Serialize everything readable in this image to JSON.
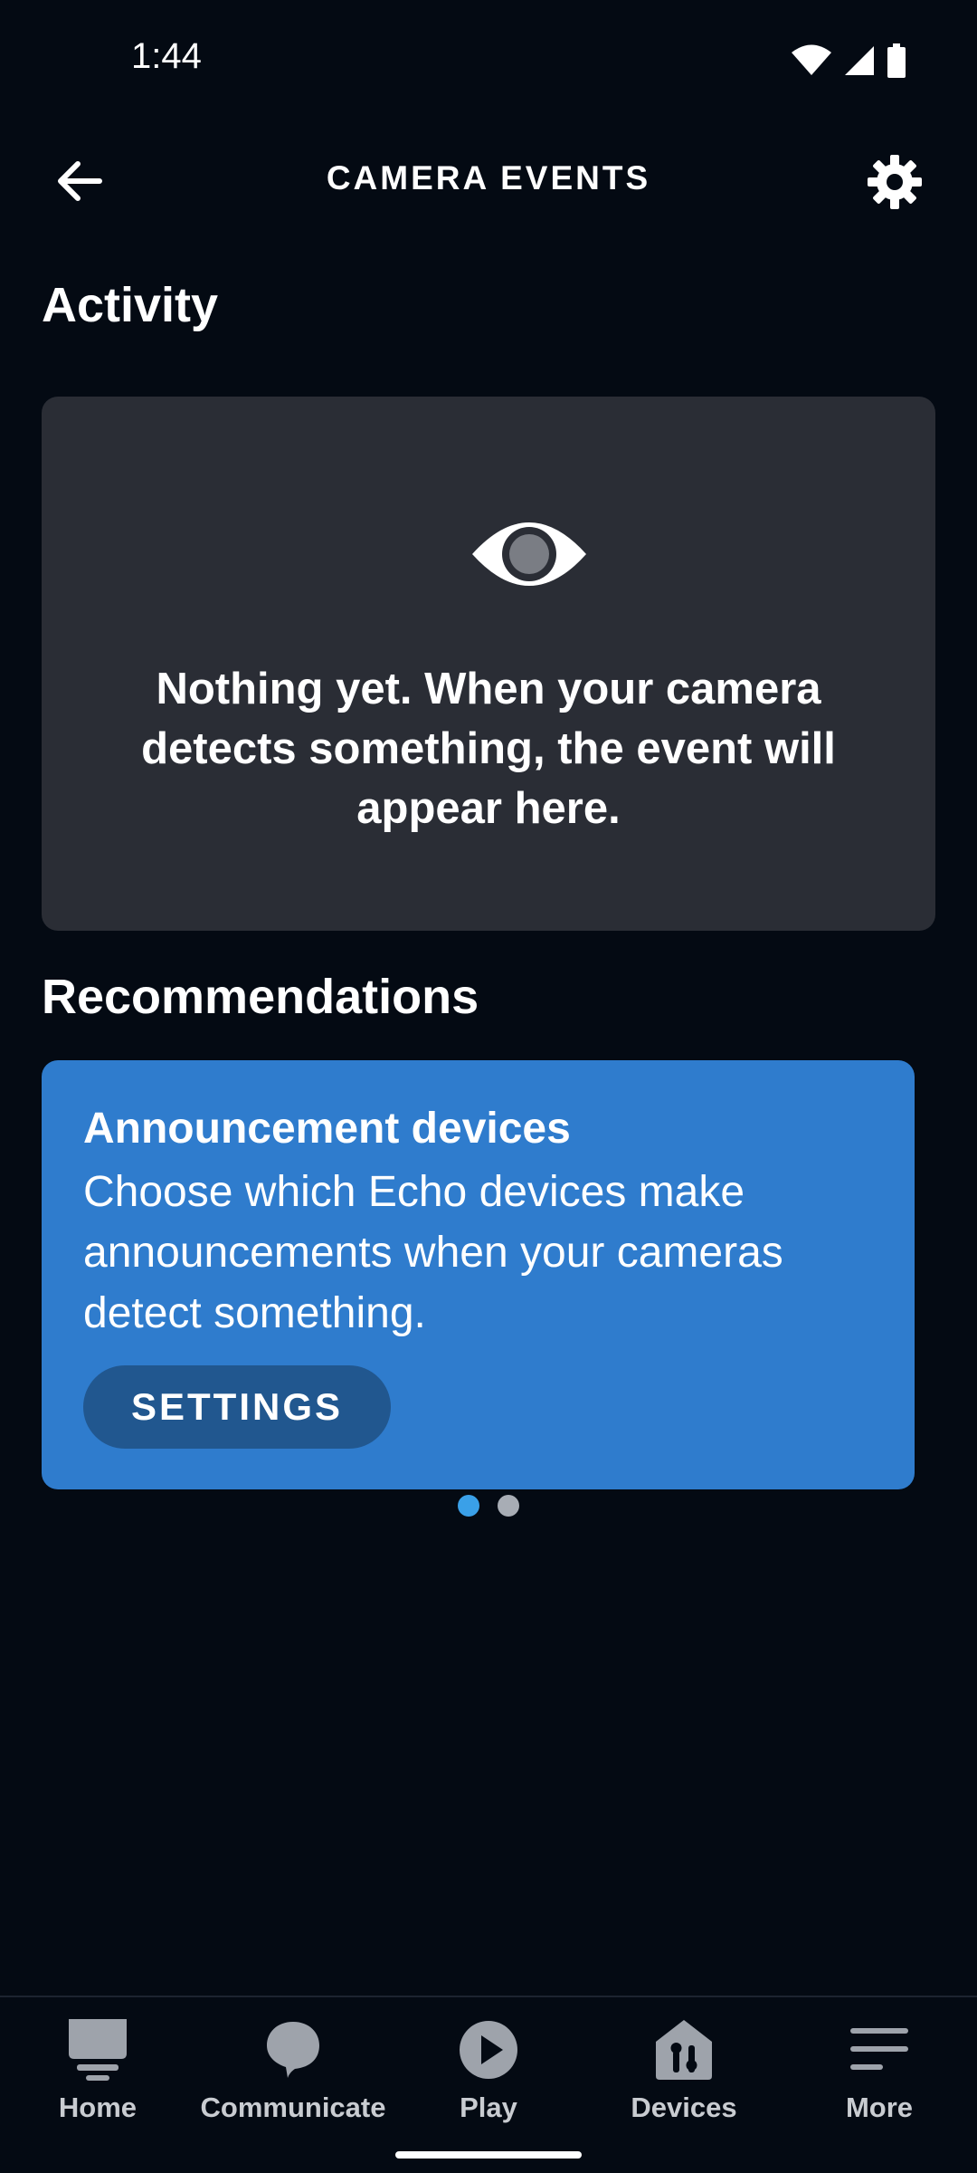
{
  "status_bar": {
    "time": "1:44"
  },
  "app_bar": {
    "title": "CAMERA EVENTS"
  },
  "activity": {
    "section_title": "Activity",
    "empty_message": "Nothing yet. When your camera detects something, the event will appear here."
  },
  "recommendations": {
    "section_title": "Recommendations",
    "card": {
      "heading": "Announcement devices",
      "body": "Choose which Echo devices make announcements when your cameras detect something.",
      "button_label": "SETTINGS"
    },
    "pager": {
      "total": 2,
      "active_index": 0
    }
  },
  "bottom_nav": {
    "items": [
      {
        "label": "Home",
        "icon": "home-icon"
      },
      {
        "label": "Communicate",
        "icon": "communicate-icon"
      },
      {
        "label": "Play",
        "icon": "play-icon"
      },
      {
        "label": "Devices",
        "icon": "devices-icon"
      },
      {
        "label": "More",
        "icon": "more-icon"
      }
    ]
  },
  "colors": {
    "background": "#040a13",
    "card_dark": "#2a2d35",
    "card_blue": "#2f7ccd",
    "button_blue": "#21578f",
    "pager_active": "#3aa0e8"
  }
}
